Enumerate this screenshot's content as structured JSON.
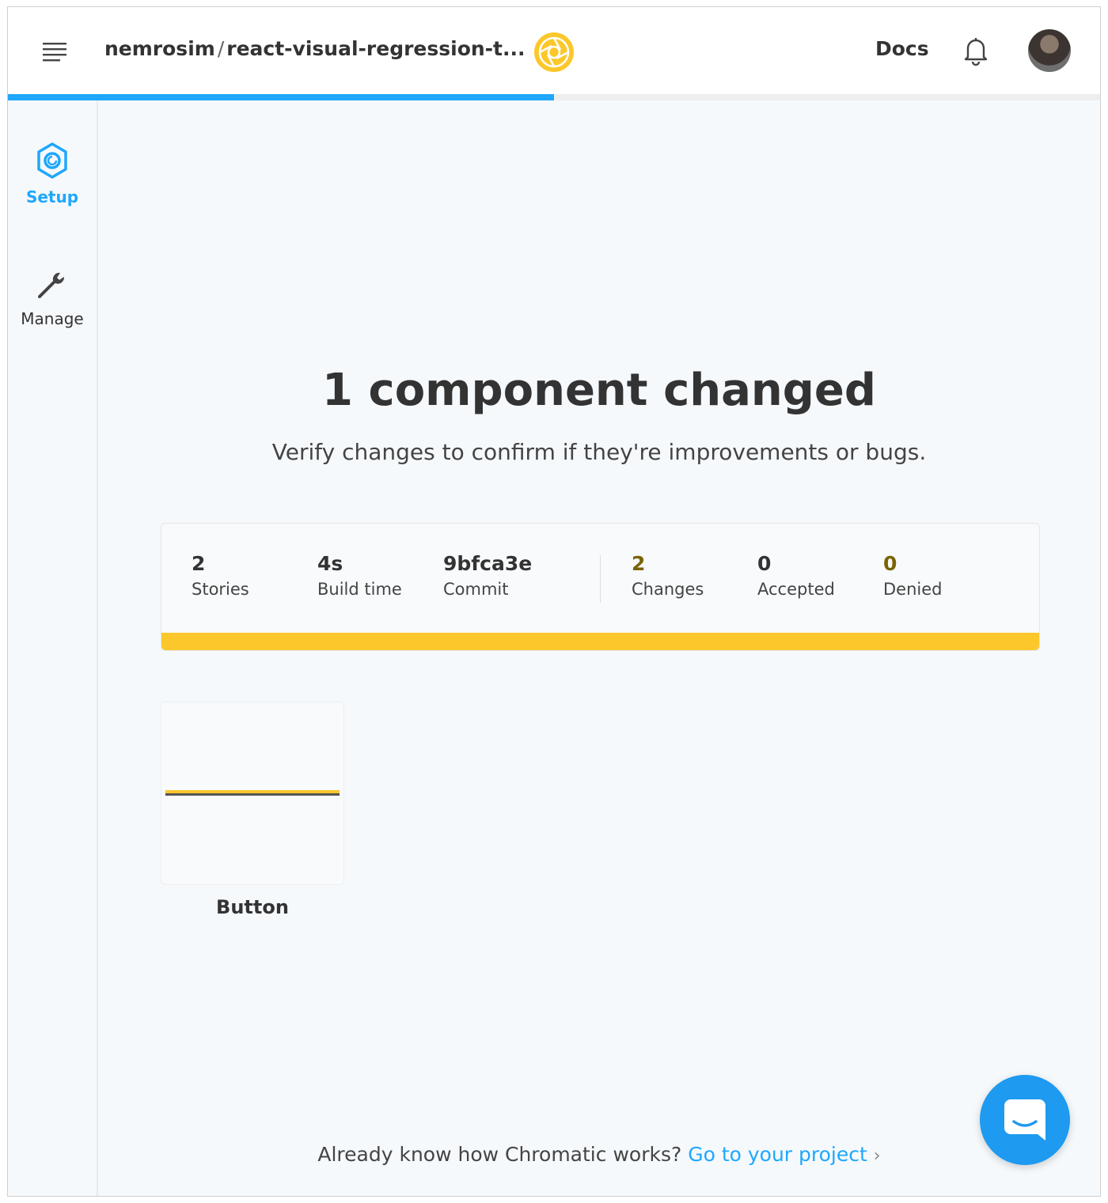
{
  "header": {
    "owner": "nemrosim",
    "separator": "/",
    "repo": "react-visual-regression-t...",
    "docs_label": "Docs",
    "progress_percent": 50
  },
  "sidebar": {
    "items": [
      {
        "label": "Setup",
        "icon": "chromatic-setup-icon",
        "active": true
      },
      {
        "label": "Manage",
        "icon": "wrench-icon",
        "active": false
      }
    ]
  },
  "main": {
    "headline": "1 component changed",
    "subhead": "Verify changes to confirm if they're improvements or bugs.",
    "stats": [
      {
        "value": "2",
        "label": "Stories"
      },
      {
        "value": "4s",
        "label": "Build time"
      },
      {
        "value": "9bfca3e",
        "label": "Commit"
      },
      {
        "value": "2",
        "label": "Changes"
      },
      {
        "value": "0",
        "label": "Accepted"
      },
      {
        "value": "0",
        "label": "Denied"
      }
    ],
    "components": [
      {
        "name": "Button"
      }
    ]
  },
  "footer": {
    "text": "Already know how Chromatic works?",
    "link": "Go to your project",
    "chevron": "›"
  },
  "colors": {
    "accent": "#1ea7fd",
    "warning": "#fcc72a",
    "chat": "#1e9af0"
  }
}
